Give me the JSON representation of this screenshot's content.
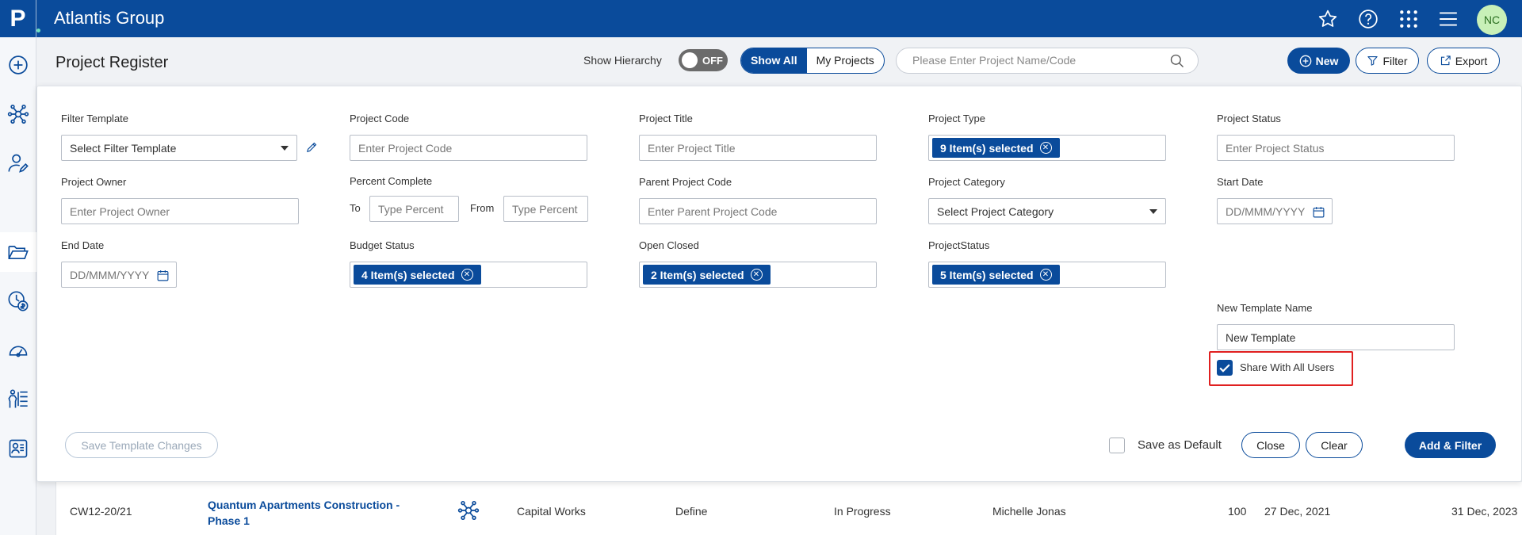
{
  "app": {
    "title": "Atlantis Group",
    "logo_letter": "P",
    "avatar_initials": "NC"
  },
  "header": {
    "page_title": "Project Register",
    "show_hierarchy_label": "Show Hierarchy",
    "toggle_label": "OFF",
    "seg_show_all": "Show All",
    "seg_my_projects": "My Projects",
    "search_placeholder": "Please Enter Project Name/Code",
    "new_label": "New",
    "filter_label": "Filter",
    "export_label": "Export"
  },
  "filters": {
    "filter_template": {
      "label": "Filter Template",
      "value": "Select Filter Template"
    },
    "project_code": {
      "label": "Project Code",
      "placeholder": "Enter Project Code"
    },
    "project_title": {
      "label": "Project Title",
      "placeholder": "Enter Project Title"
    },
    "project_type": {
      "label": "Project Type",
      "chip": "9 Item(s) selected"
    },
    "project_status": {
      "label": "Project Status",
      "placeholder": "Enter Project Status"
    },
    "project_owner": {
      "label": "Project Owner",
      "placeholder": "Enter Project Owner"
    },
    "percent_complete": {
      "label": "Percent Complete",
      "to_label": "To",
      "from_label": "From",
      "to_placeholder": "Type Percent",
      "from_placeholder": "Type Percent"
    },
    "parent_project_code": {
      "label": "Parent Project Code",
      "placeholder": "Enter Parent Project Code"
    },
    "project_category": {
      "label": "Project Category",
      "value": "Select Project Category"
    },
    "start_date": {
      "label": "Start Date",
      "placeholder": "DD/MMM/YYYY"
    },
    "end_date": {
      "label": "End Date",
      "placeholder": "DD/MMM/YYYY"
    },
    "budget_status": {
      "label": "Budget Status",
      "chip": "4 Item(s) selected"
    },
    "open_closed": {
      "label": "Open Closed",
      "chip": "2 Item(s) selected"
    },
    "project_status2": {
      "label": "ProjectStatus",
      "chip": "5 Item(s) selected"
    },
    "new_template_name": {
      "label": "New Template Name",
      "value": "New Template"
    },
    "share_with_all": {
      "label": "Share With All Users",
      "checked": true
    },
    "save_as_default": {
      "label": "Save as Default",
      "checked": false
    }
  },
  "actions": {
    "save_template_changes": "Save Template Changes",
    "close": "Close",
    "clear": "Clear",
    "add_filter": "Add & Filter"
  },
  "table_row": {
    "code": "CW12-20/21",
    "name": "Quantum Apartments Construction - Phase 1",
    "type": "Capital Works",
    "phase": "Define",
    "status": "In Progress",
    "owner": "Michelle Jonas",
    "percent": "100",
    "start": "27 Dec, 2021",
    "end": "31 Dec, 2023"
  },
  "colors": {
    "brand": "#0a4b9b",
    "highlight": "#e02020"
  }
}
